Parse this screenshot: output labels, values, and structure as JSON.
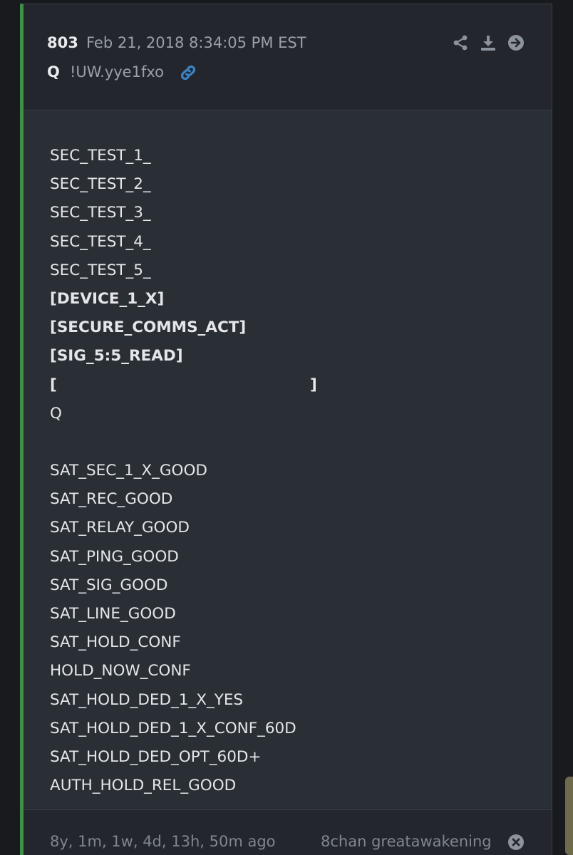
{
  "post": {
    "number": "803",
    "date": "Feb 21, 2018 8:34:05 PM EST",
    "author": "Q",
    "tripcode": "!UW.yye1fxo"
  },
  "icons": {
    "link": "link-icon",
    "share": "share-icon",
    "download": "download-icon",
    "go": "arrow-right-circle-icon",
    "close": "close-circle-icon"
  },
  "lines": [
    {
      "text": "SEC_TEST_1_",
      "bold": false
    },
    {
      "text": "SEC_TEST_2_",
      "bold": false
    },
    {
      "text": "SEC_TEST_3_",
      "bold": false
    },
    {
      "text": "SEC_TEST_4_",
      "bold": false
    },
    {
      "text": "SEC_TEST_5_",
      "bold": false
    },
    {
      "text": "[DEVICE_1_X]",
      "bold": true
    },
    {
      "text": "[SECURE_COMMS_ACT]",
      "bold": true
    },
    {
      "text": "[SIG_5:5_READ]",
      "bold": true
    },
    {
      "text": "[",
      "bold": true,
      "closing": "]"
    },
    {
      "text": "Q",
      "bold": false
    },
    {
      "text": "",
      "bold": false
    },
    {
      "text": "SAT_SEC_1_X_GOOD",
      "bold": false
    },
    {
      "text": "SAT_REC_GOOD",
      "bold": false
    },
    {
      "text": "SAT_RELAY_GOOD",
      "bold": false
    },
    {
      "text": "SAT_PING_GOOD",
      "bold": false
    },
    {
      "text": "SAT_SIG_GOOD",
      "bold": false
    },
    {
      "text": "SAT_LINE_GOOD",
      "bold": false
    },
    {
      "text": "SAT_HOLD_CONF",
      "bold": false
    },
    {
      "text": "HOLD_NOW_CONF",
      "bold": false
    },
    {
      "text": "SAT_HOLD_DED_1_X_YES",
      "bold": false
    },
    {
      "text": "SAT_HOLD_DED_1_X_CONF_60D",
      "bold": false
    },
    {
      "text": "SAT_HOLD_DED_OPT_60D+",
      "bold": false
    },
    {
      "text": "AUTH_HOLD_REL_GOOD",
      "bold": false
    }
  ],
  "footer": {
    "relative_time": "8y, 1m, 1w, 4d, 13h, 50m ago",
    "source": "8chan greatawakening"
  },
  "colors": {
    "accent_bar": "#3f8f49",
    "link": "#3b82c4"
  }
}
